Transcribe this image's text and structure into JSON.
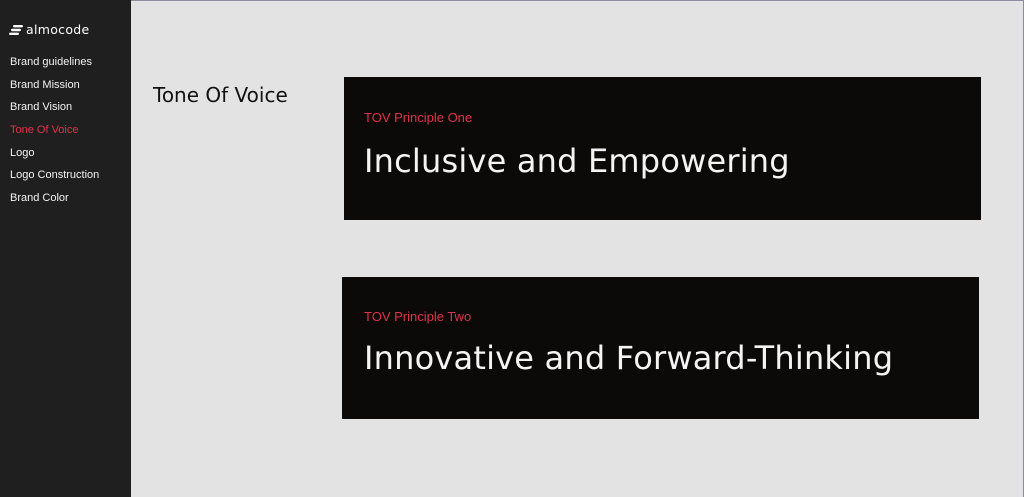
{
  "brand": {
    "name": "almocode",
    "logo_icon": "stacked-bars-logo-icon"
  },
  "sidebar": {
    "items": [
      {
        "label": "Brand guidelines",
        "active": false
      },
      {
        "label": "Brand Mission",
        "active": false
      },
      {
        "label": "Brand Vision",
        "active": false
      },
      {
        "label": "Tone Of Voice",
        "active": true
      },
      {
        "label": "Logo",
        "active": false
      },
      {
        "label": "Logo Construction",
        "active": false
      },
      {
        "label": "Brand Color",
        "active": false
      }
    ]
  },
  "main": {
    "section_title": "Tone Of Voice",
    "principles": [
      {
        "label": "TOV Principle One",
        "title": "Inclusive and Empowering"
      },
      {
        "label": "TOV Principle Two",
        "title": "Innovative and Forward-Thinking"
      }
    ]
  },
  "colors": {
    "sidebar_bg": "#1f1f1f",
    "content_bg": "#e3e3e3",
    "card_bg": "#0c0909",
    "accent": "#e0324a",
    "card_text": "#f4f4f4"
  }
}
